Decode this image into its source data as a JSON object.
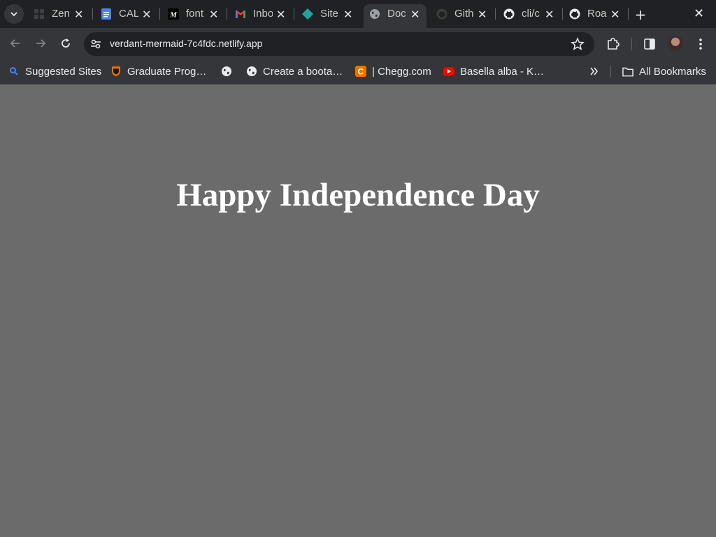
{
  "browser": {
    "tabs": [
      {
        "title": "Zen",
        "favicon": "grid-icon",
        "active": false
      },
      {
        "title": "CAL",
        "favicon": "google-docs-icon",
        "active": false
      },
      {
        "title": "font",
        "favicon": "m-logo-icon",
        "active": false
      },
      {
        "title": "Inbo",
        "favicon": "gmail-icon",
        "active": false
      },
      {
        "title": "Site",
        "favicon": "diamond-icon",
        "active": false
      },
      {
        "title": "Doc",
        "favicon": "globe-icon",
        "active": true
      },
      {
        "title": "Gith",
        "favicon": "github-icon",
        "active": false
      },
      {
        "title": "cli/c",
        "favicon": "github-icon",
        "active": false
      },
      {
        "title": "Roa",
        "favicon": "github-icon",
        "active": false
      }
    ],
    "address_bar": {
      "url": "verdant-mermaid-7c4fdc.netlify.app"
    },
    "bookmarks": [
      {
        "label": "Suggested Sites",
        "icon": "search-icon"
      },
      {
        "label": "Graduate Prog…",
        "icon": "princeton-shield-icon"
      },
      {
        "label": "",
        "icon": "globe-icon"
      },
      {
        "label": "Create a boota…",
        "icon": "globe-icon"
      },
      {
        "label": "| Chegg.com",
        "icon": "chegg-icon"
      },
      {
        "label": "Basella alba - K…",
        "icon": "youtube-icon"
      }
    ],
    "all_bookmarks_label": "All Bookmarks"
  },
  "page": {
    "heading": "Happy Independence Day",
    "background_color": "#6b6b6b",
    "heading_color": "#ffffff"
  }
}
